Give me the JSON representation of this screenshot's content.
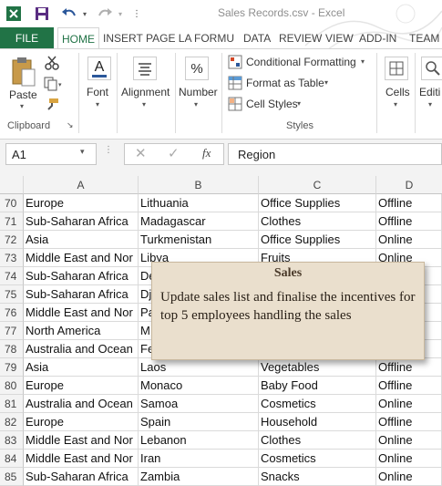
{
  "window": {
    "title": "Sales Records.csv - Excel"
  },
  "quick_access": {
    "save_icon": "save-icon",
    "undo_icon": "undo-icon",
    "redo_icon": "redo-icon"
  },
  "tabs": [
    "FILE",
    "HOME",
    "INSERT",
    "PAGE LA",
    "FORMU",
    "DATA",
    "REVIEW",
    "VIEW",
    "ADD-IN",
    "TEAM"
  ],
  "ribbon": {
    "paste": "Paste",
    "clipboard": "Clipboard",
    "font": "Font",
    "alignment": "Alignment",
    "number": "Number",
    "number_symbol": "%",
    "conditional_formatting": "Conditional Formatting",
    "format_as_table": "Format as Table",
    "cell_styles": "Cell Styles",
    "styles": "Styles",
    "cells": "Cells",
    "editing": "Editi"
  },
  "formula_bar": {
    "name_box": "A1",
    "fx": "fx",
    "value": "Region"
  },
  "columns": [
    "A",
    "B",
    "C",
    "D"
  ],
  "rows": [
    {
      "n": "70",
      "a": "Europe",
      "b": "Lithuania",
      "c": "Office Supplies",
      "d": "Offline"
    },
    {
      "n": "71",
      "a": "Sub-Saharan Africa",
      "b": "Madagascar",
      "c": "Clothes",
      "d": "Offline"
    },
    {
      "n": "72",
      "a": "Asia",
      "b": "Turkmenistan",
      "c": "Office Supplies",
      "d": "Online"
    },
    {
      "n": "73",
      "a": "Middle East and Nor",
      "b": "Libya",
      "c": "Fruits",
      "d": "Online"
    },
    {
      "n": "74",
      "a": "Sub-Saharan Africa",
      "b": "De",
      "c": "",
      "d": ""
    },
    {
      "n": "75",
      "a": "Sub-Saharan Africa",
      "b": "Dj",
      "c": "",
      "d": ""
    },
    {
      "n": "76",
      "a": "Middle East and Nor",
      "b": "Pa",
      "c": "",
      "d": ""
    },
    {
      "n": "77",
      "a": "North America",
      "b": "M",
      "c": "",
      "d": ""
    },
    {
      "n": "78",
      "a": "Australia and Ocean",
      "b": "Fe",
      "c": "",
      "d": ""
    },
    {
      "n": "79",
      "a": "Asia",
      "b": "Laos",
      "c": "Vegetables",
      "d": "Offline"
    },
    {
      "n": "80",
      "a": "Europe",
      "b": "Monaco",
      "c": "Baby Food",
      "d": "Offline"
    },
    {
      "n": "81",
      "a": "Australia and Ocean",
      "b": "Samoa",
      "c": "Cosmetics",
      "d": "Online"
    },
    {
      "n": "82",
      "a": "Europe",
      "b": "Spain",
      "c": "Household",
      "d": "Offline"
    },
    {
      "n": "83",
      "a": "Middle East and Nor",
      "b": "Lebanon",
      "c": "Clothes",
      "d": "Online"
    },
    {
      "n": "84",
      "a": "Middle East and Nor",
      "b": "Iran",
      "c": "Cosmetics",
      "d": "Online"
    },
    {
      "n": "85",
      "a": "Sub-Saharan Africa",
      "b": "Zambia",
      "c": "Snacks",
      "d": "Online"
    }
  ],
  "comment": {
    "title": "Sales",
    "body": "Update sales list and finalise the incentives for top 5 employees handling the sales"
  },
  "colors": {
    "accent": "#217346",
    "comment_bg": "#eadfcd"
  }
}
